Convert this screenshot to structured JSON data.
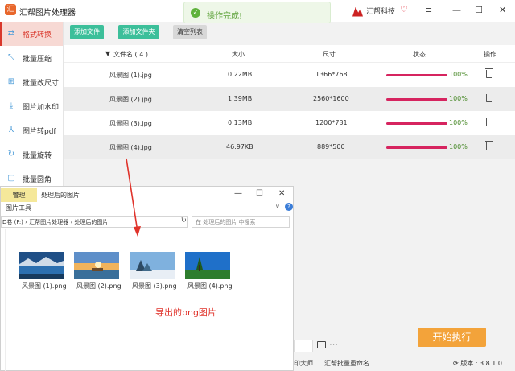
{
  "app": {
    "title": "汇帮图片处理器",
    "logo_letter": "汇",
    "brand": "汇帮科技"
  },
  "toast": {
    "message": "操作完成!"
  },
  "sidebar": {
    "items": [
      {
        "label": "格式转换",
        "icon": "convert-icon"
      },
      {
        "label": "批量压缩",
        "icon": "compress-icon"
      },
      {
        "label": "批量改尺寸",
        "icon": "resize-icon"
      },
      {
        "label": "图片加水印",
        "icon": "watermark-icon"
      },
      {
        "label": "图片转pdf",
        "icon": "pdf-icon"
      },
      {
        "label": "批量旋转",
        "icon": "rotate-icon"
      },
      {
        "label": "批量圆角",
        "icon": "round-corner-icon"
      }
    ]
  },
  "toolbar": {
    "add_file": "添加文件",
    "add_folder": "添加文件夹",
    "clear_list": "清空列表"
  },
  "table": {
    "headers": {
      "name": "文件名 ( 4 )",
      "size": "大小",
      "dimension": "尺寸",
      "status": "状态",
      "action": "操作"
    },
    "rows": [
      {
        "name": "风景图 (1).jpg",
        "size": "0.22MB",
        "dim": "1366*768",
        "pct": "100%"
      },
      {
        "name": "风景图 (2).jpg",
        "size": "1.39MB",
        "dim": "2560*1600",
        "pct": "100%"
      },
      {
        "name": "风景图 (3).jpg",
        "size": "0.13MB",
        "dim": "1200*731",
        "pct": "100%"
      },
      {
        "name": "风景图 (4).jpg",
        "size": "46.97KB",
        "dim": "889*500",
        "pct": "100%"
      }
    ]
  },
  "explorer": {
    "manage": "管理",
    "title": "处理后的图片",
    "tools": "图片工具",
    "address": "D卷 (F:) › 汇帮图片处理器 › 处理后的图片",
    "search_placeholder": "在 处理后的图片 中搜索",
    "files": [
      {
        "name": "风景图 (1).png"
      },
      {
        "name": "风景图 (2).png"
      },
      {
        "name": "风景图 (3).png"
      },
      {
        "name": "风景图 (4).png"
      }
    ]
  },
  "annotation": "导出的png图片",
  "start_button": "开始执行",
  "bottom": {
    "link1": "印大师",
    "link2": "汇帮批量重命名",
    "version": "版本 : 3.8.1.0"
  },
  "colors": {
    "accent": "#d9372b",
    "progress": "#d6245f",
    "add_btn": "#3cbf9a",
    "start": "#f3a33a"
  }
}
